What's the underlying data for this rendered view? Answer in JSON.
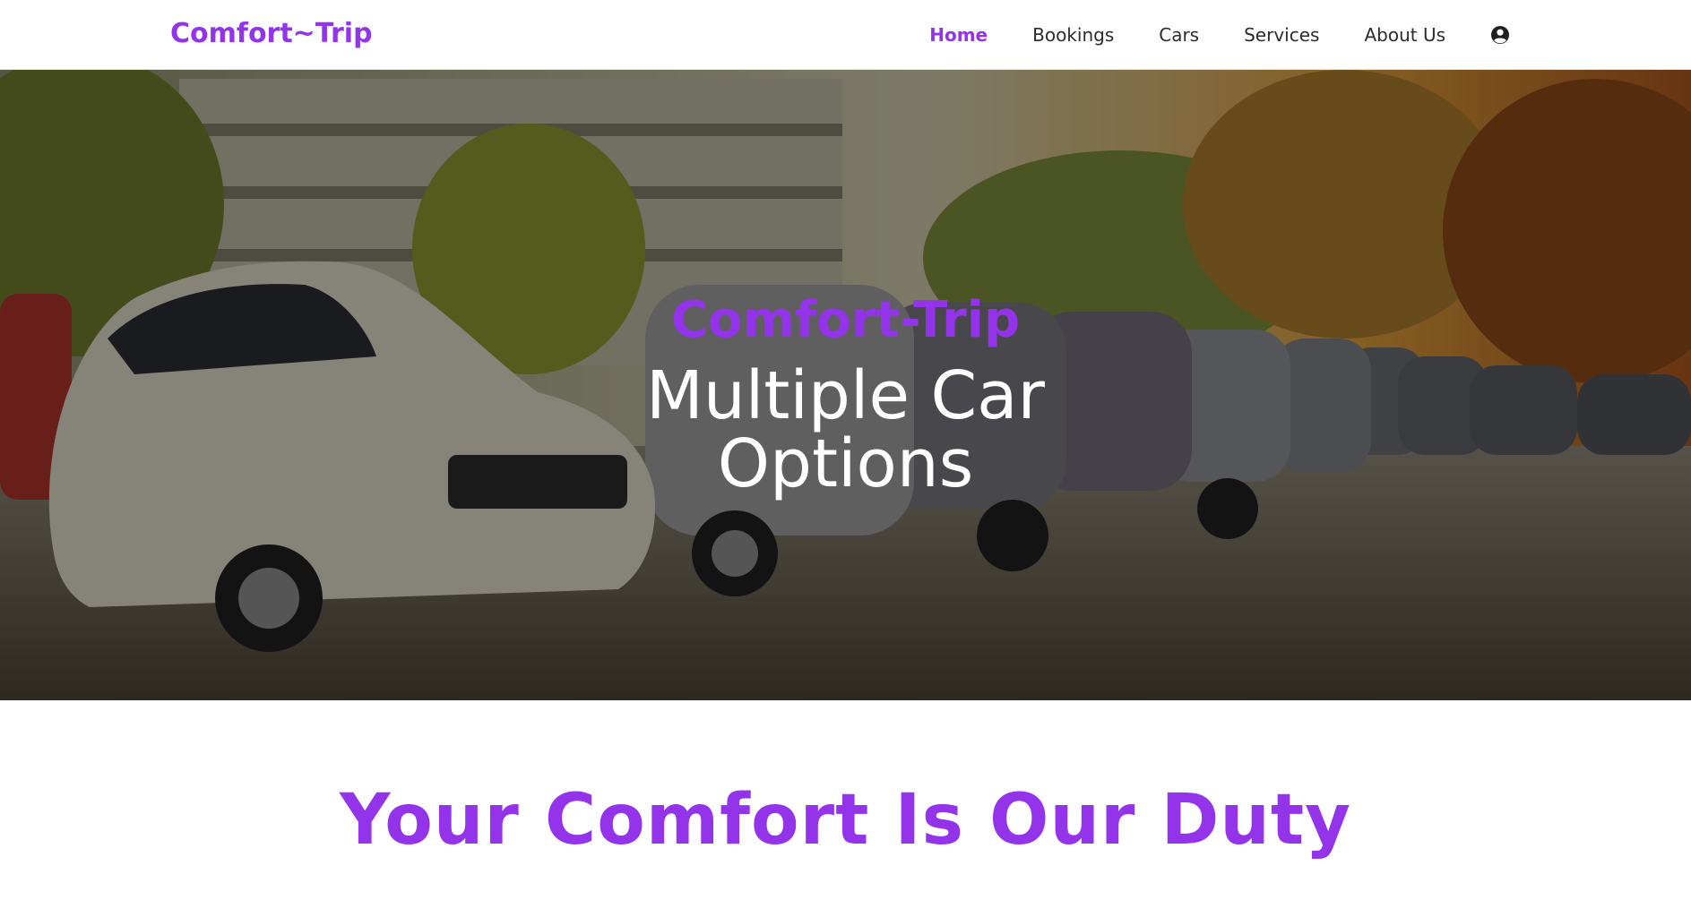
{
  "brand": {
    "logo_text": "Comfort~Trip",
    "accent_color": "#9333ea"
  },
  "nav": {
    "items": [
      {
        "label": "Home",
        "active": true
      },
      {
        "label": "Bookings",
        "active": false
      },
      {
        "label": "Cars",
        "active": false
      },
      {
        "label": "Services",
        "active": false
      },
      {
        "label": "About Us",
        "active": false
      }
    ],
    "account_icon": "user-circle-icon"
  },
  "hero": {
    "background": "parked-cars-photo",
    "brand_title": "Comfort-Trip",
    "headline": "Multiple Car Options"
  },
  "tagline": {
    "text": "Your Comfort Is Our Duty"
  }
}
